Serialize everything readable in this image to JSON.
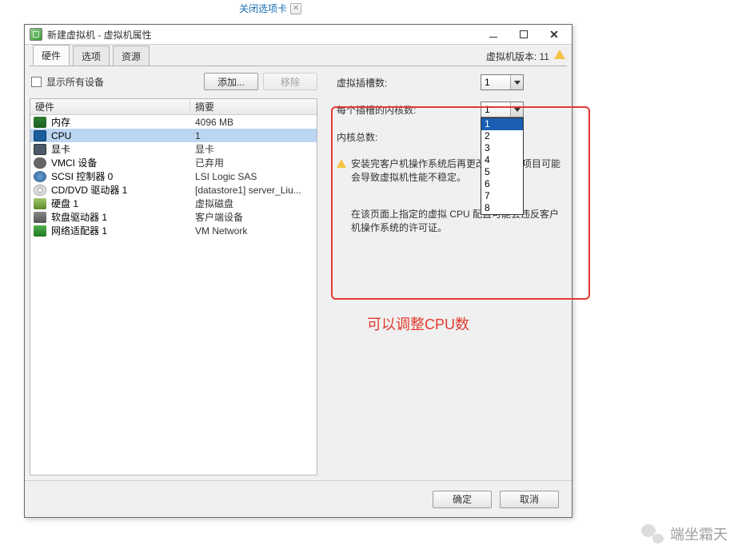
{
  "top_link": {
    "label": "关闭选项卡"
  },
  "window": {
    "title": "新建虚拟机 - 虚拟机属性",
    "version_label": "虚拟机版本: 11"
  },
  "tabs": [
    {
      "label": "硬件",
      "active": true
    },
    {
      "label": "选项",
      "active": false
    },
    {
      "label": "资源",
      "active": false
    }
  ],
  "toolbar": {
    "show_all_label": "显示所有设备",
    "add_label": "添加...",
    "remove_label": "移除"
  },
  "table": {
    "col_hw": "硬件",
    "col_summary": "摘要",
    "rows": [
      {
        "icon": "ic-mem",
        "name": "内存",
        "summary": "4096 MB",
        "selected": false
      },
      {
        "icon": "ic-cpu",
        "name": "CPU",
        "summary": "1",
        "selected": true
      },
      {
        "icon": "ic-video",
        "name": "显卡",
        "summary": "显卡",
        "selected": false
      },
      {
        "icon": "ic-vmci",
        "name": "VMCI 设备",
        "summary": "已弃用",
        "selected": false
      },
      {
        "icon": "ic-scsi",
        "name": "SCSI 控制器 0",
        "summary": "LSI Logic SAS",
        "selected": false
      },
      {
        "icon": "ic-cd",
        "name": "CD/DVD 驱动器 1",
        "summary": "[datastore1] server_Liu...",
        "selected": false
      },
      {
        "icon": "ic-disk",
        "name": "硬盘 1",
        "summary": "虚拟磁盘",
        "selected": false
      },
      {
        "icon": "ic-floppy",
        "name": "软盘驱动器 1",
        "summary": "客户端设备",
        "selected": false
      },
      {
        "icon": "ic-net",
        "name": "网络适配器 1",
        "summary": "VM Network",
        "selected": false
      }
    ]
  },
  "cpu_panel": {
    "sockets_label": "虚拟插槽数:",
    "sockets_value": "1",
    "cores_label": "每个插槽的内核数:",
    "cores_value": "1",
    "total_label": "内核总数:",
    "warn_text_1": "安装完客户机操作系统后再更改",
    "warn_text_2": "项目可能会导致虚拟机性能不稳定。",
    "note_text": "在该页面上指定的虚拟 CPU 配置可能会违反客户机操作系统的许可证。",
    "dropdown_options": [
      "1",
      "2",
      "3",
      "4",
      "5",
      "6",
      "7",
      "8"
    ]
  },
  "annotation": "可以调整CPU数",
  "footer": {
    "ok": "确定",
    "cancel": "取消"
  },
  "watermark": "端坐霜天"
}
